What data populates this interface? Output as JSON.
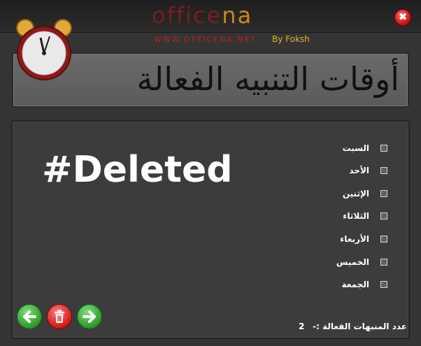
{
  "header": {
    "logo_part1": "office",
    "logo_part2": "na",
    "website": "WWW.OFFICENA.NET",
    "author": "By Foksh",
    "close_glyph": "✖"
  },
  "title": "أوقات التنبيه الفعالة",
  "main": {
    "deleted_text": "#Deleted",
    "days": [
      {
        "label": "السبت",
        "checked": false
      },
      {
        "label": "الأحد",
        "checked": false
      },
      {
        "label": "الإثنين",
        "checked": false
      },
      {
        "label": "الثلاثاء",
        "checked": false
      },
      {
        "label": "الأربعاء",
        "checked": false
      },
      {
        "label": "الخميس",
        "checked": false
      },
      {
        "label": "الجمعة",
        "checked": false
      }
    ],
    "buttons": [
      {
        "name": "previous",
        "icon": "arrow-left-icon",
        "color": "#2e9a2a"
      },
      {
        "name": "delete",
        "icon": "trash-icon",
        "color": "#d61717"
      },
      {
        "name": "next",
        "icon": "arrow-right-icon",
        "color": "#2e9a2a"
      }
    ],
    "active_count_label": "عدد المنبهات الفعالة :-",
    "active_count_value": "2"
  },
  "colors": {
    "background": "#343434",
    "title_panel": "#6b6b6b",
    "logo_dark_red": "#7a1d1d",
    "logo_orange": "#c98712",
    "author_yellow": "#e6b422"
  }
}
